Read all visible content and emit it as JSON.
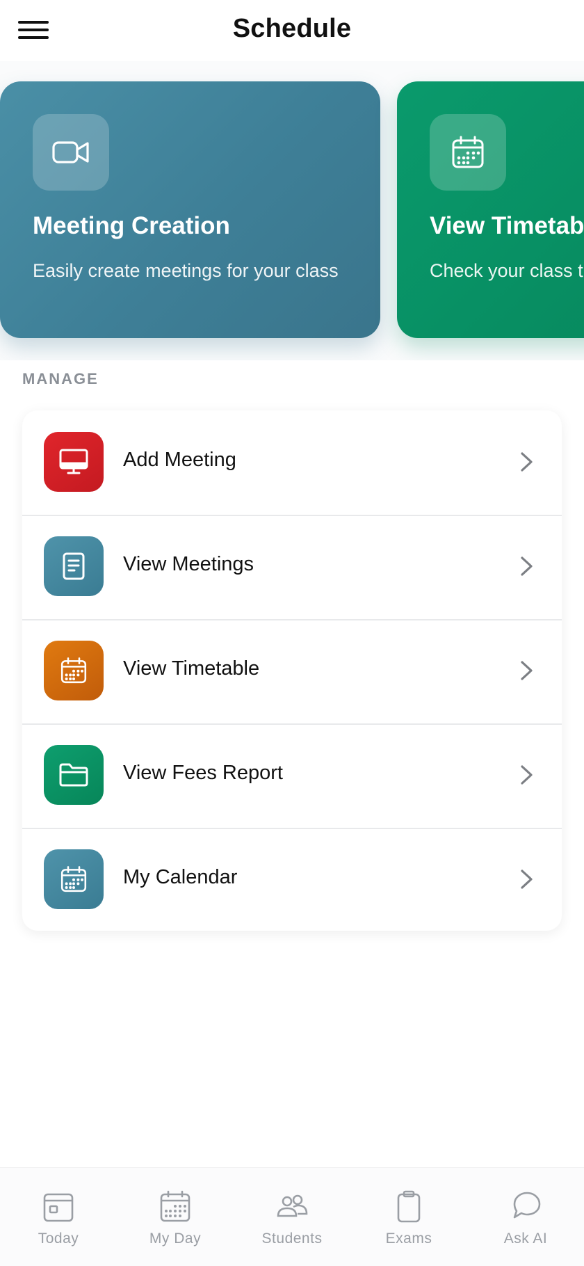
{
  "header": {
    "title": "Schedule",
    "menu_icon": "hamburger-menu-icon"
  },
  "carousel": {
    "cards": [
      {
        "title": "Meeting Creation",
        "description": "Easily create meetings for your class",
        "icon": "video-camera-icon",
        "color": "#448aa2"
      },
      {
        "title": "View Timetable",
        "description": "Check your class timetable",
        "icon": "calendar-icon",
        "color": "#089367"
      }
    ]
  },
  "section": {
    "label": "MANAGE"
  },
  "menu": {
    "items": [
      {
        "label": "Add Meeting",
        "icon": "monitor-icon",
        "color": "#d9232a"
      },
      {
        "label": "View Meetings",
        "icon": "document-icon",
        "color": "#448aa2"
      },
      {
        "label": "View Timetable",
        "icon": "calendar-icon",
        "color": "#d46c0e"
      },
      {
        "label": "View Fees Report",
        "icon": "folder-icon",
        "color": "#0a9467"
      },
      {
        "label": "My Calendar",
        "icon": "calendar-icon",
        "color": "#448aa2"
      }
    ]
  },
  "bottom_nav": {
    "items": [
      {
        "label": "Today",
        "icon": "calendar-today-icon"
      },
      {
        "label": "My Day",
        "icon": "calendar-grid-icon"
      },
      {
        "label": "Students",
        "icon": "people-icon"
      },
      {
        "label": "Exams",
        "icon": "clipboard-icon"
      },
      {
        "label": "Ask AI",
        "icon": "chat-bubble-icon"
      }
    ]
  }
}
